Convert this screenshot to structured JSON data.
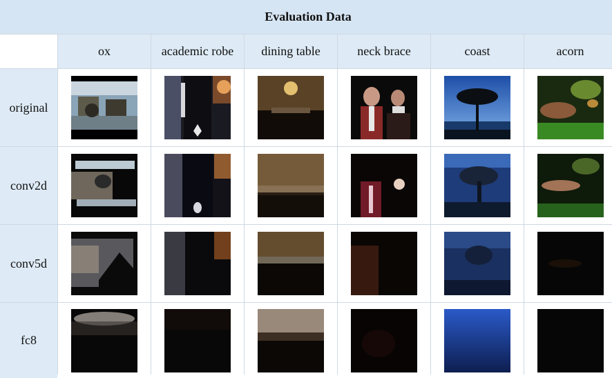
{
  "table": {
    "title": "Evaluation Data",
    "columns": [
      "ox",
      "academic robe",
      "dining table",
      "neck brace",
      "coast",
      "acorn"
    ],
    "rows": [
      "original",
      "conv2d",
      "conv5d",
      "fc8"
    ]
  },
  "icons": {
    "cell_image": "photo-thumbnail"
  }
}
